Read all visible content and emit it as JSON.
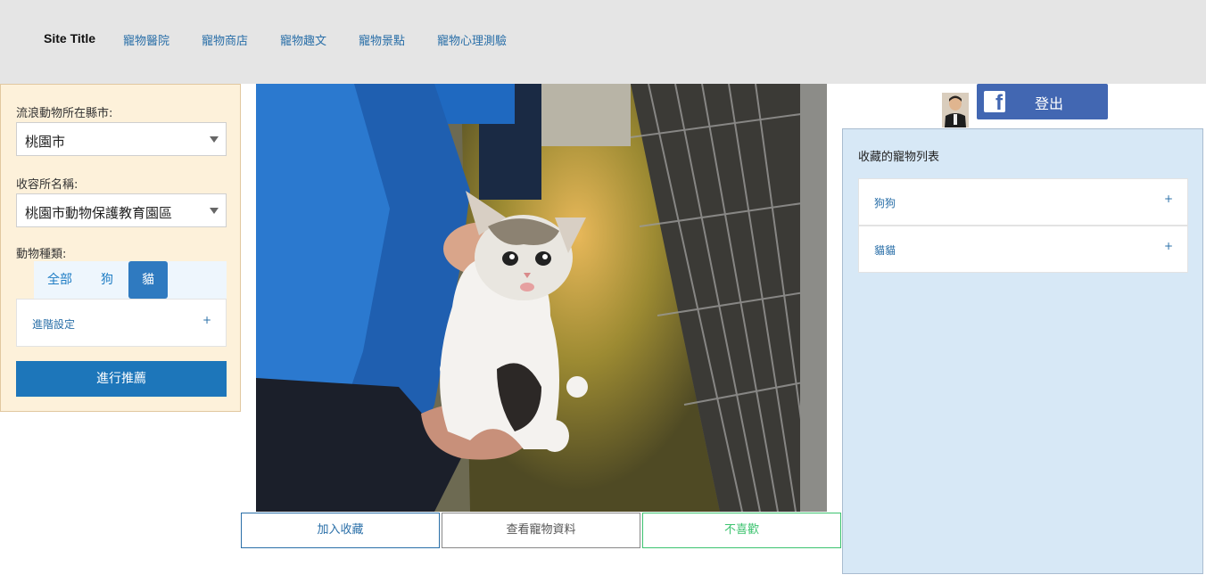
{
  "nav": {
    "site_title": "Site Title",
    "links": [
      "寵物醫院",
      "寵物商店",
      "寵物趣文",
      "寵物景點",
      "寵物心理測驗"
    ]
  },
  "filters": {
    "city_label": "流浪動物所在縣市:",
    "city_value": "桃園市",
    "shelter_label": "收容所名稱:",
    "shelter_value": "桃園市動物保護教育園區",
    "kind_label": "動物種類:",
    "kind_options": [
      "全部",
      "狗",
      "貓"
    ],
    "kind_selected": "貓",
    "advanced_label": "進階設定",
    "advanced_toggle": "+",
    "recommend_label": "進行推薦"
  },
  "photo": {
    "icon": "kitten-photo"
  },
  "actions": {
    "favorite_label": "加入收藏",
    "details_label": "查看寵物資料",
    "dislike_label": "不喜歡"
  },
  "account": {
    "logout_label": "登出",
    "brand_icon": "facebook-icon"
  },
  "favorites": {
    "title": "收藏的寵物列表",
    "items": [
      {
        "label": "狗狗",
        "toggle": "+"
      },
      {
        "label": "貓貓",
        "toggle": "+"
      }
    ]
  },
  "colors": {
    "nav_bg": "#e5e5e5",
    "accent_blue": "#1d76ba",
    "facebook_blue": "#4267b2",
    "dislike_green": "#3cc36f",
    "filter_bg": "#fdf1da",
    "favorites_bg": "#d7e8f6"
  }
}
